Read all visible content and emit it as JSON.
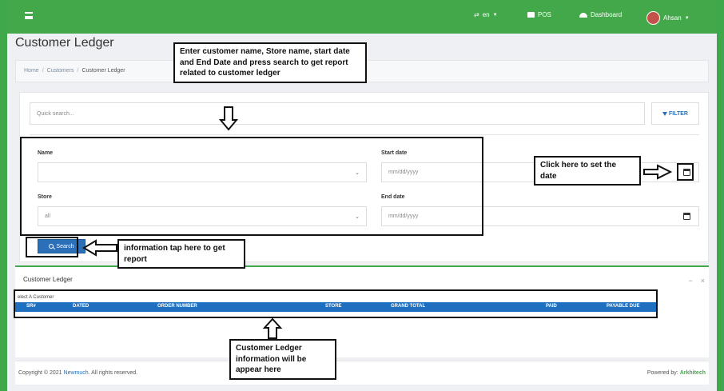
{
  "navbar": {
    "lang_label": "en",
    "pos_label": "POS",
    "dashboard_label": "Dashboard",
    "user_name": "Ahsan"
  },
  "page": {
    "title": "Customer Ledger",
    "breadcrumb": [
      "Home",
      "Customers",
      "Customer Ledger"
    ]
  },
  "search_card": {
    "quick_search_placeholder": "Quick search...",
    "filter_label": "FILTER",
    "name_label": "Name",
    "name_value": "",
    "store_label": "Store",
    "store_value": "all",
    "start_date_label": "Start date",
    "start_date_placeholder": "mm/dd/yyyy",
    "end_date_label": "End date",
    "end_date_placeholder": "mm/dd/yyyy",
    "search_button": "Search"
  },
  "ledger": {
    "title": "Customer Ledger",
    "minimize": "−",
    "close": "×",
    "hint": "elect A Customer",
    "columns": [
      "SR#",
      "DATED",
      "ORDER NUMBER",
      "STORE",
      "GRAND TOTAL",
      "PAID",
      "PAYABLE DUE"
    ]
  },
  "footer": {
    "copyright_prefix": "Copyright © 2021",
    "copyright_brand": "Newmuch.",
    "copyright_suffix": "All rights reserved.",
    "powered_prefix": "Powered by:",
    "powered_brand": "Arkhitech"
  },
  "annotations": {
    "top_note": "Enter customer name, Store name, start date and End Date and press search to get report related to customer ledger",
    "date_note": "Click here to set the date",
    "search_note": "information tap here to get report",
    "ledger_note": "Customer Ledger information will be appear here"
  },
  "colors": {
    "accent_green": "#43a84a",
    "primary_blue": "#2a6fb8",
    "table_header": "#1f6fc0"
  }
}
